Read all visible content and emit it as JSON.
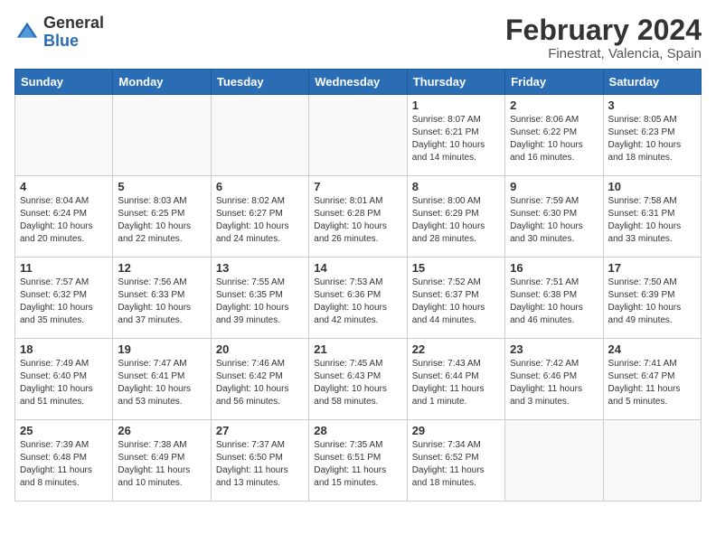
{
  "logo": {
    "general": "General",
    "blue": "Blue"
  },
  "header": {
    "month_year": "February 2024",
    "location": "Finestrat, Valencia, Spain"
  },
  "weekdays": [
    "Sunday",
    "Monday",
    "Tuesday",
    "Wednesday",
    "Thursday",
    "Friday",
    "Saturday"
  ],
  "weeks": [
    [
      {
        "day": "",
        "info": ""
      },
      {
        "day": "",
        "info": ""
      },
      {
        "day": "",
        "info": ""
      },
      {
        "day": "",
        "info": ""
      },
      {
        "day": "1",
        "info": "Sunrise: 8:07 AM\nSunset: 6:21 PM\nDaylight: 10 hours\nand 14 minutes."
      },
      {
        "day": "2",
        "info": "Sunrise: 8:06 AM\nSunset: 6:22 PM\nDaylight: 10 hours\nand 16 minutes."
      },
      {
        "day": "3",
        "info": "Sunrise: 8:05 AM\nSunset: 6:23 PM\nDaylight: 10 hours\nand 18 minutes."
      }
    ],
    [
      {
        "day": "4",
        "info": "Sunrise: 8:04 AM\nSunset: 6:24 PM\nDaylight: 10 hours\nand 20 minutes."
      },
      {
        "day": "5",
        "info": "Sunrise: 8:03 AM\nSunset: 6:25 PM\nDaylight: 10 hours\nand 22 minutes."
      },
      {
        "day": "6",
        "info": "Sunrise: 8:02 AM\nSunset: 6:27 PM\nDaylight: 10 hours\nand 24 minutes."
      },
      {
        "day": "7",
        "info": "Sunrise: 8:01 AM\nSunset: 6:28 PM\nDaylight: 10 hours\nand 26 minutes."
      },
      {
        "day": "8",
        "info": "Sunrise: 8:00 AM\nSunset: 6:29 PM\nDaylight: 10 hours\nand 28 minutes."
      },
      {
        "day": "9",
        "info": "Sunrise: 7:59 AM\nSunset: 6:30 PM\nDaylight: 10 hours\nand 30 minutes."
      },
      {
        "day": "10",
        "info": "Sunrise: 7:58 AM\nSunset: 6:31 PM\nDaylight: 10 hours\nand 33 minutes."
      }
    ],
    [
      {
        "day": "11",
        "info": "Sunrise: 7:57 AM\nSunset: 6:32 PM\nDaylight: 10 hours\nand 35 minutes."
      },
      {
        "day": "12",
        "info": "Sunrise: 7:56 AM\nSunset: 6:33 PM\nDaylight: 10 hours\nand 37 minutes."
      },
      {
        "day": "13",
        "info": "Sunrise: 7:55 AM\nSunset: 6:35 PM\nDaylight: 10 hours\nand 39 minutes."
      },
      {
        "day": "14",
        "info": "Sunrise: 7:53 AM\nSunset: 6:36 PM\nDaylight: 10 hours\nand 42 minutes."
      },
      {
        "day": "15",
        "info": "Sunrise: 7:52 AM\nSunset: 6:37 PM\nDaylight: 10 hours\nand 44 minutes."
      },
      {
        "day": "16",
        "info": "Sunrise: 7:51 AM\nSunset: 6:38 PM\nDaylight: 10 hours\nand 46 minutes."
      },
      {
        "day": "17",
        "info": "Sunrise: 7:50 AM\nSunset: 6:39 PM\nDaylight: 10 hours\nand 49 minutes."
      }
    ],
    [
      {
        "day": "18",
        "info": "Sunrise: 7:49 AM\nSunset: 6:40 PM\nDaylight: 10 hours\nand 51 minutes."
      },
      {
        "day": "19",
        "info": "Sunrise: 7:47 AM\nSunset: 6:41 PM\nDaylight: 10 hours\nand 53 minutes."
      },
      {
        "day": "20",
        "info": "Sunrise: 7:46 AM\nSunset: 6:42 PM\nDaylight: 10 hours\nand 56 minutes."
      },
      {
        "day": "21",
        "info": "Sunrise: 7:45 AM\nSunset: 6:43 PM\nDaylight: 10 hours\nand 58 minutes."
      },
      {
        "day": "22",
        "info": "Sunrise: 7:43 AM\nSunset: 6:44 PM\nDaylight: 11 hours\nand 1 minute."
      },
      {
        "day": "23",
        "info": "Sunrise: 7:42 AM\nSunset: 6:46 PM\nDaylight: 11 hours\nand 3 minutes."
      },
      {
        "day": "24",
        "info": "Sunrise: 7:41 AM\nSunset: 6:47 PM\nDaylight: 11 hours\nand 5 minutes."
      }
    ],
    [
      {
        "day": "25",
        "info": "Sunrise: 7:39 AM\nSunset: 6:48 PM\nDaylight: 11 hours\nand 8 minutes."
      },
      {
        "day": "26",
        "info": "Sunrise: 7:38 AM\nSunset: 6:49 PM\nDaylight: 11 hours\nand 10 minutes."
      },
      {
        "day": "27",
        "info": "Sunrise: 7:37 AM\nSunset: 6:50 PM\nDaylight: 11 hours\nand 13 minutes."
      },
      {
        "day": "28",
        "info": "Sunrise: 7:35 AM\nSunset: 6:51 PM\nDaylight: 11 hours\nand 15 minutes."
      },
      {
        "day": "29",
        "info": "Sunrise: 7:34 AM\nSunset: 6:52 PM\nDaylight: 11 hours\nand 18 minutes."
      },
      {
        "day": "",
        "info": ""
      },
      {
        "day": "",
        "info": ""
      }
    ]
  ]
}
